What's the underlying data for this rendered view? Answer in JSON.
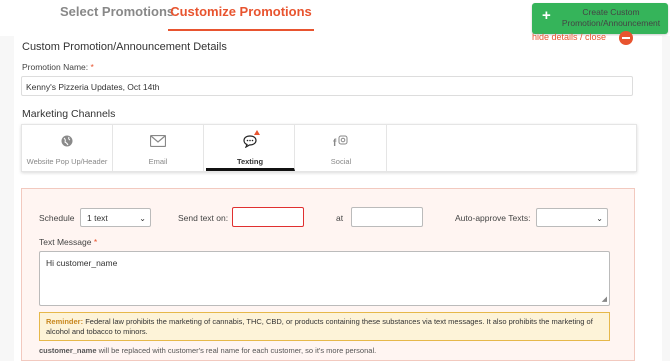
{
  "tabs": {
    "select": "Select Promotions",
    "customize": "Customize Promotions"
  },
  "create_button": {
    "icon": "+",
    "label": "Create Custom Promotion/Announcement"
  },
  "hide_link": "hide details / close",
  "section_title": "Custom Promotion/Announcement Details",
  "promotion_name": {
    "label": "Promotion Name:",
    "required": "*",
    "value": "Kenny's Pizzeria Updates, Oct 14th"
  },
  "marketing": {
    "title": "Marketing Channels",
    "channels": [
      {
        "label": "Website Pop Up/Header",
        "icon": "globe-icon"
      },
      {
        "label": "Email",
        "icon": "envelope-icon"
      },
      {
        "label": "Texting",
        "icon": "chat-bubble-icon",
        "active": true
      },
      {
        "label": "Social",
        "icon": "social-icon"
      }
    ]
  },
  "texting_form": {
    "schedule_label": "Schedule",
    "schedule_value": "1 text",
    "send_on_label": "Send text on:",
    "send_on_value": "",
    "at_label": "at",
    "at_value": "",
    "auto_approve_label": "Auto-approve Texts:",
    "auto_approve_value": "",
    "message_label": "Text Message",
    "message_required": "*",
    "message_value": "Hi customer_name",
    "reminder_title": "Reminder:",
    "reminder_text": "Federal law prohibits the marketing of cannabis, THC, CBD, or products containing these substances via text messages. It also prohibits the marketing of alcohol and tobacco to minors.",
    "footnote_key": "customer_name",
    "footnote_text": "will be replaced with customer's real name for each customer, so it's more personal."
  },
  "colors": {
    "accent": "#e8542f",
    "green": "#35b45a"
  }
}
